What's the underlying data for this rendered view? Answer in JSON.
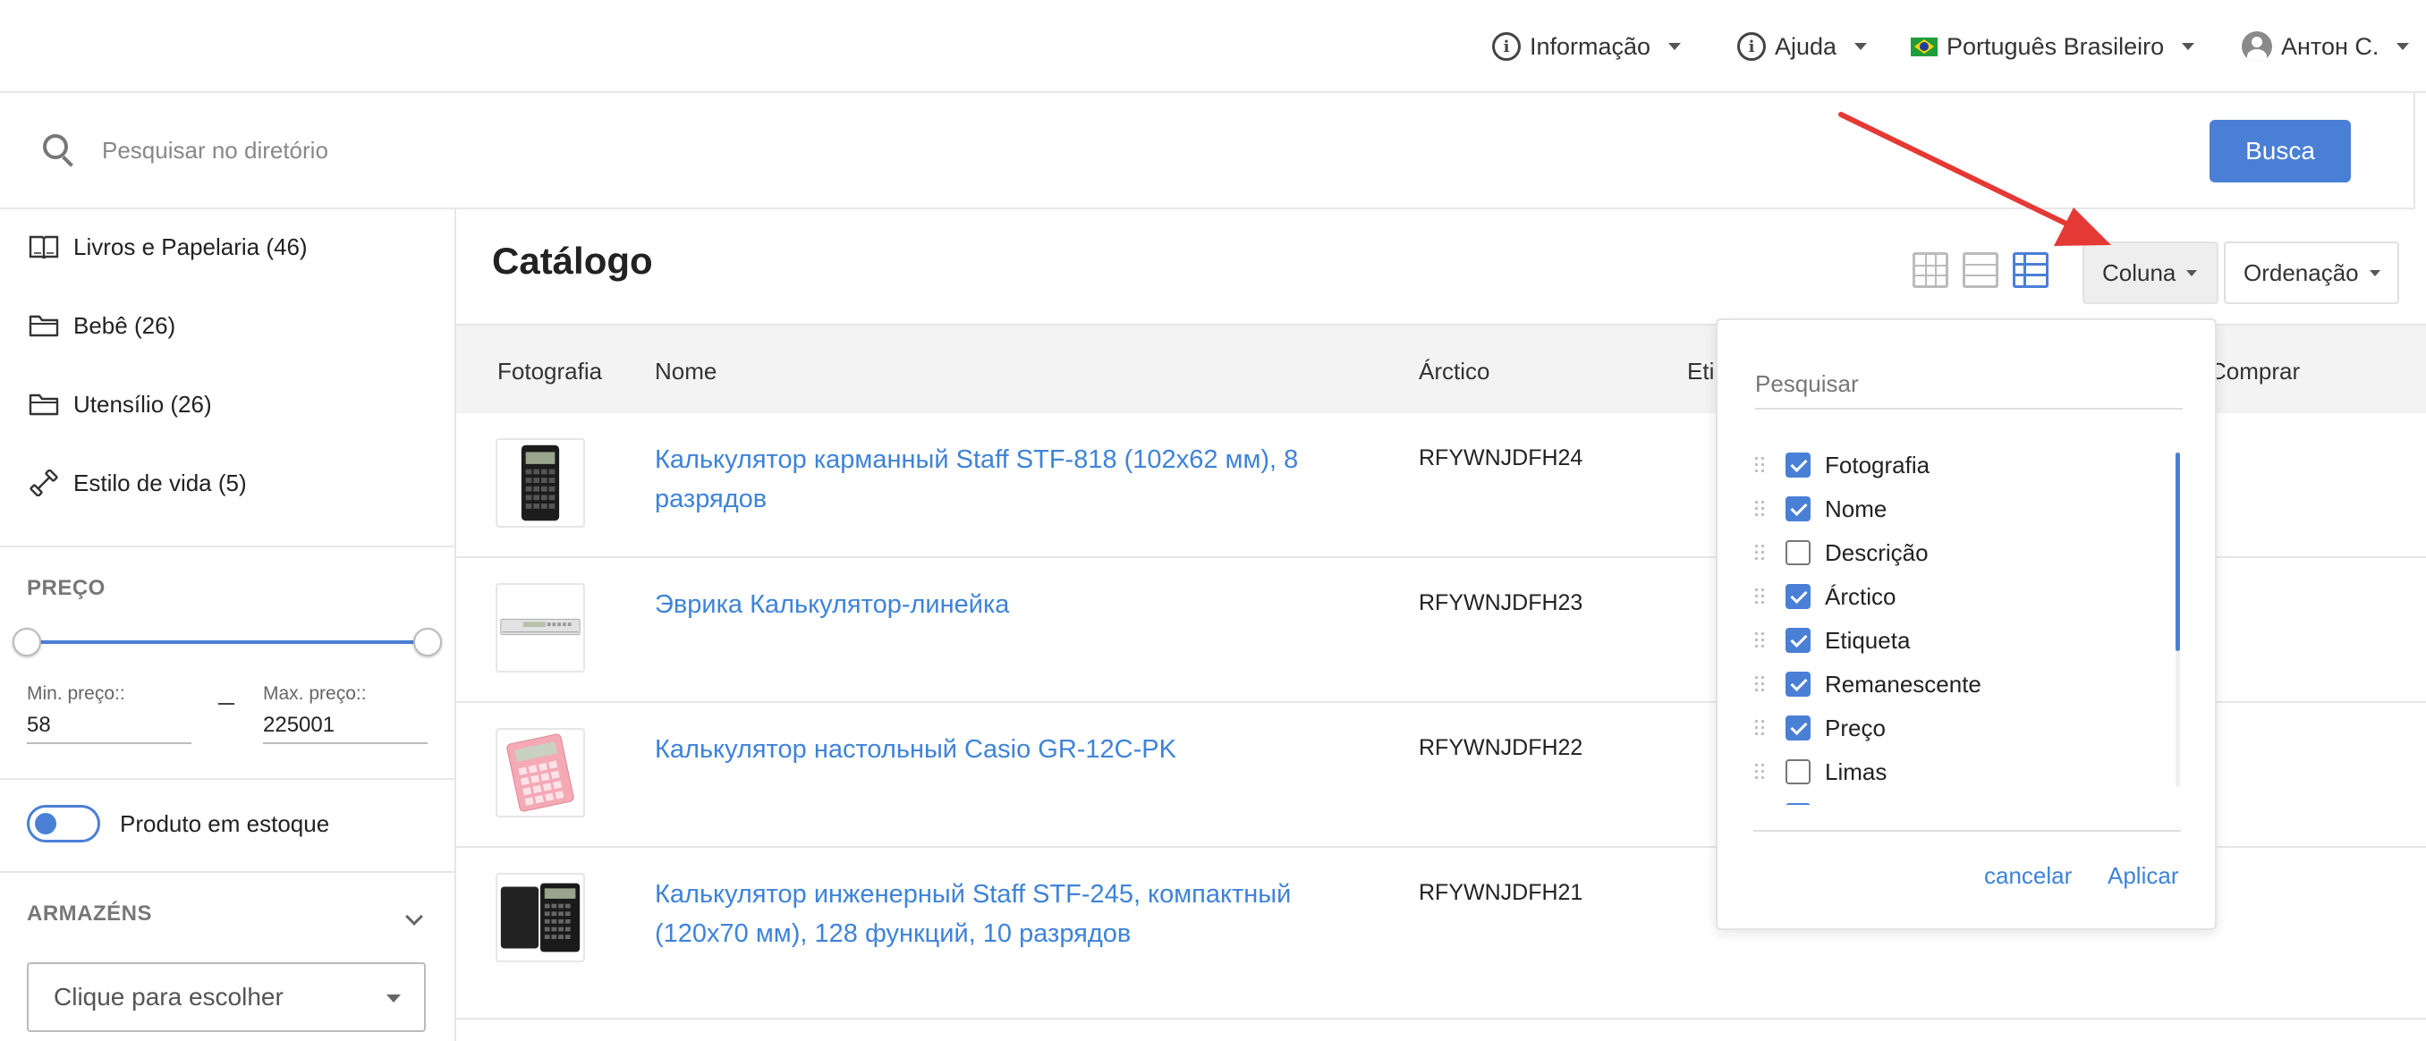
{
  "topbar": {
    "info_label": "Informação",
    "help_label": "Ajuda",
    "language_label": "Português Brasileiro",
    "user_label": "Антон С."
  },
  "search": {
    "placeholder": "Pesquisar no diretório",
    "button_label": "Busca"
  },
  "sidebar": {
    "categories": [
      {
        "label": "Livros e Papelaria (46)",
        "icon": "book-icon"
      },
      {
        "label": "Bebê (26)",
        "icon": "folder-icon"
      },
      {
        "label": "Utensílio (26)",
        "icon": "folder-icon"
      },
      {
        "label": "Estilo de vida (5)",
        "icon": "dumbbell-icon"
      }
    ],
    "price": {
      "title": "PREÇO",
      "min_label": "Min. preço::",
      "min_value": "58",
      "max_label": "Max. preço::",
      "max_value": "225001"
    },
    "in_stock_label": "Produto em estoque",
    "warehouses": {
      "title": "ARMAZÉNS",
      "select_placeholder": "Clique para escolher"
    }
  },
  "main": {
    "title": "Catálogo",
    "column_button": "Coluna",
    "sort_button": "Ordenação",
    "headers": {
      "photo": "Fotografia",
      "name": "Nome",
      "sku": "Árctico",
      "tag_partial": "Eti",
      "buy": "Comprar"
    },
    "rows": [
      {
        "name": "Калькулятор карманный Staff STF-818 (102x62 мм), 8 разрядов",
        "sku": "RFYWNJDFH24"
      },
      {
        "name": "Эврика Калькулятор-линейка",
        "sku": "RFYWNJDFH23"
      },
      {
        "name": "Калькулятор настольный Casio GR-12C-PK",
        "sku": "RFYWNJDFH22"
      },
      {
        "name": "Калькулятор инженерный Staff STF-245, компактный (120x70 мм), 128 функций, 10 разрядов",
        "sku": "RFYWNJDFH21"
      }
    ]
  },
  "column_panel": {
    "search_placeholder": "Pesquisar",
    "items": [
      {
        "label": "Fotografia",
        "checked": true
      },
      {
        "label": "Nome",
        "checked": true
      },
      {
        "label": "Descrição",
        "checked": false
      },
      {
        "label": "Árctico",
        "checked": true
      },
      {
        "label": "Etiqueta",
        "checked": true
      },
      {
        "label": "Remanescente",
        "checked": true
      },
      {
        "label": "Preço",
        "checked": true
      },
      {
        "label": "Limas",
        "checked": false
      }
    ],
    "cancel_label": "cancelar",
    "apply_label": "Aplicar"
  },
  "colors": {
    "accent": "#4a7fd6",
    "link": "#3e83d8",
    "annotation_arrow": "#e53935"
  }
}
